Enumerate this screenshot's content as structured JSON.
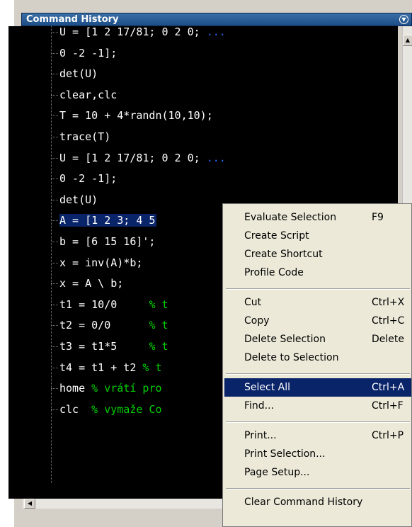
{
  "window": {
    "title": "Command History"
  },
  "history": {
    "items": [
      {
        "code": "U = [1 2 17/81; 0 2 0; ",
        "comment": "",
        "cont": "..."
      },
      {
        "code": "0 -2 -1];",
        "comment": "",
        "cont": ""
      },
      {
        "code": "det(U)",
        "comment": "",
        "cont": ""
      },
      {
        "code": "clear,clc",
        "comment": "",
        "cont": ""
      },
      {
        "code": "T = 10 + 4*randn(10,10);",
        "comment": "",
        "cont": ""
      },
      {
        "code": "trace(T)",
        "comment": "",
        "cont": ""
      },
      {
        "code": "U = [1 2 17/81; 0 2 0; ",
        "comment": "",
        "cont": "..."
      },
      {
        "code": "0 -2 -1];",
        "comment": "",
        "cont": ""
      },
      {
        "code": "det(U)",
        "comment": "",
        "cont": ""
      },
      {
        "code": "A = [1 2 3; 4 5",
        "comment": "",
        "cont": "",
        "selected": true
      },
      {
        "code": "b = [6 15 16]';",
        "comment": "",
        "cont": ""
      },
      {
        "code": "x = inv(A)*b;",
        "comment": "",
        "cont": ""
      },
      {
        "code": "x = A \\ b;",
        "comment": "",
        "cont": ""
      },
      {
        "code": "t1 = 10/0     ",
        "comment": "% t",
        "cont": ""
      },
      {
        "code": "t2 = 0/0      ",
        "comment": "% t",
        "cont": ""
      },
      {
        "code": "t3 = t1*5     ",
        "comment": "% t",
        "cont": ""
      },
      {
        "code": "t4 = t1 + t2 ",
        "comment": "% t",
        "cont": ""
      },
      {
        "code": "home ",
        "comment": "% vrátí pro",
        "cont": ""
      },
      {
        "code": "clc  ",
        "comment": "% vymaže Co",
        "cont": ""
      }
    ]
  },
  "context_menu": {
    "items": [
      {
        "label": "Evaluate Selection",
        "shortcut": "F9"
      },
      {
        "label": "Create Script",
        "shortcut": ""
      },
      {
        "label": "Create Shortcut",
        "shortcut": ""
      },
      {
        "label": "Profile Code",
        "shortcut": ""
      },
      {
        "label": "Cut",
        "shortcut": "Ctrl+X"
      },
      {
        "label": "Copy",
        "shortcut": "Ctrl+C"
      },
      {
        "label": "Delete Selection",
        "shortcut": "Delete"
      },
      {
        "label": "Delete to Selection",
        "shortcut": ""
      },
      {
        "label": "Select All",
        "shortcut": "Ctrl+A",
        "highlighted": true
      },
      {
        "label": "Find...",
        "shortcut": "Ctrl+F"
      },
      {
        "label": "Print...",
        "shortcut": "Ctrl+P"
      },
      {
        "label": "Print Selection...",
        "shortcut": ""
      },
      {
        "label": "Page Setup...",
        "shortcut": ""
      },
      {
        "label": "Clear Command History",
        "shortcut": ""
      }
    ]
  },
  "colors": {
    "selection": "#0a246a",
    "comment": "#00d000",
    "continuation": "#2a6aff",
    "background": "#000000"
  },
  "icons": {
    "title_menu": "chevron-down-circle-icon",
    "scroll_up": "arrow-up-icon",
    "scroll_left": "arrow-left-icon"
  }
}
